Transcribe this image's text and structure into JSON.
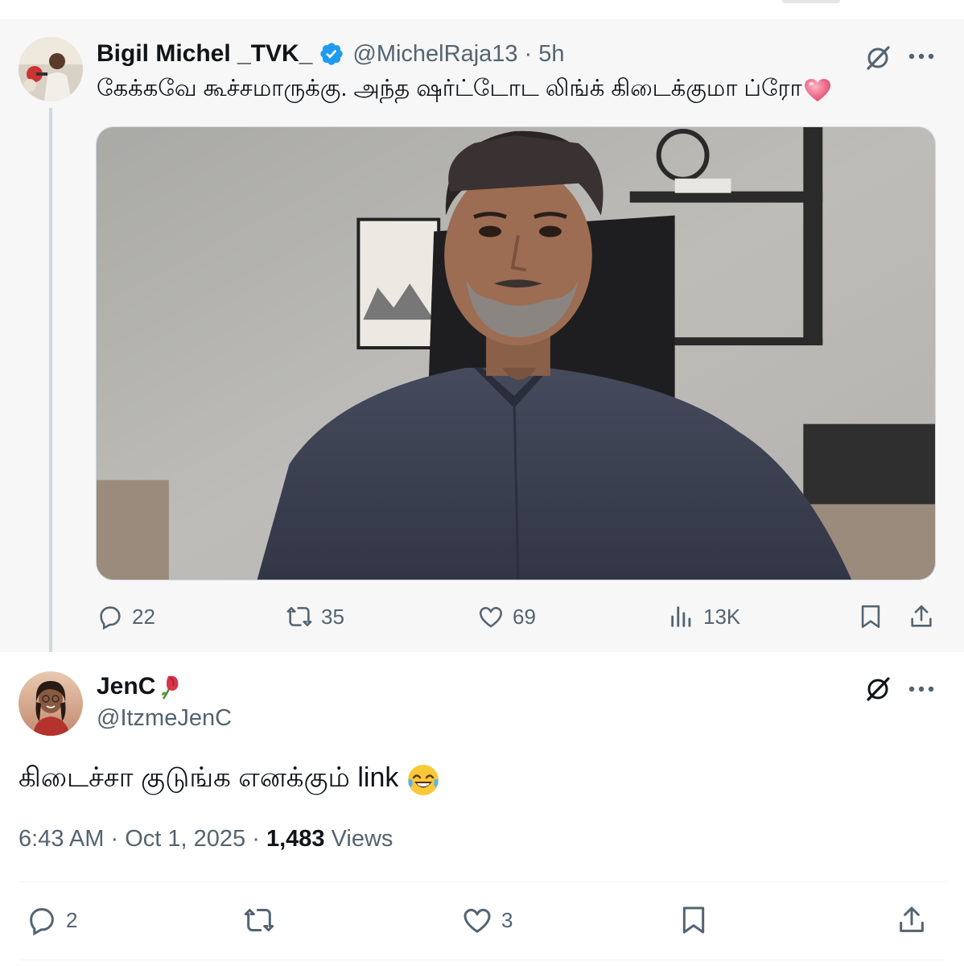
{
  "parent_tweet": {
    "author_name": "Bigil Michel _TVK_",
    "handle": "@MichelRaja13",
    "separator": "·",
    "time": "5h",
    "text": "கேக்கவே கூச்சமாருக்கு. அந்த ஷர்ட்டோட லிங்க் கிடைக்குமா ப்ரோ",
    "emoji": "heart-emoji",
    "verified": true,
    "stats": {
      "replies": "22",
      "reposts": "35",
      "likes": "69",
      "views": "13K"
    }
  },
  "reply_tweet": {
    "author_name": "JenC",
    "name_emoji": "rose-emoji",
    "handle": "@ItzmeJenC",
    "text": "கிடைச்சா குடுங்க எனக்கும் link",
    "text_emoji": "laughing-tears-emoji",
    "time": "6:43 AM",
    "separator1": "·",
    "date": "Oct 1, 2025",
    "separator2": "·",
    "views_count": "1,483",
    "views_label": "Views",
    "stats": {
      "replies": "2",
      "likes": "3"
    }
  },
  "colors": {
    "secondary_text": "#536471",
    "primary_text": "#0f1419",
    "verified_blue": "#1d9bf0",
    "thread_line": "#cfd9de"
  }
}
